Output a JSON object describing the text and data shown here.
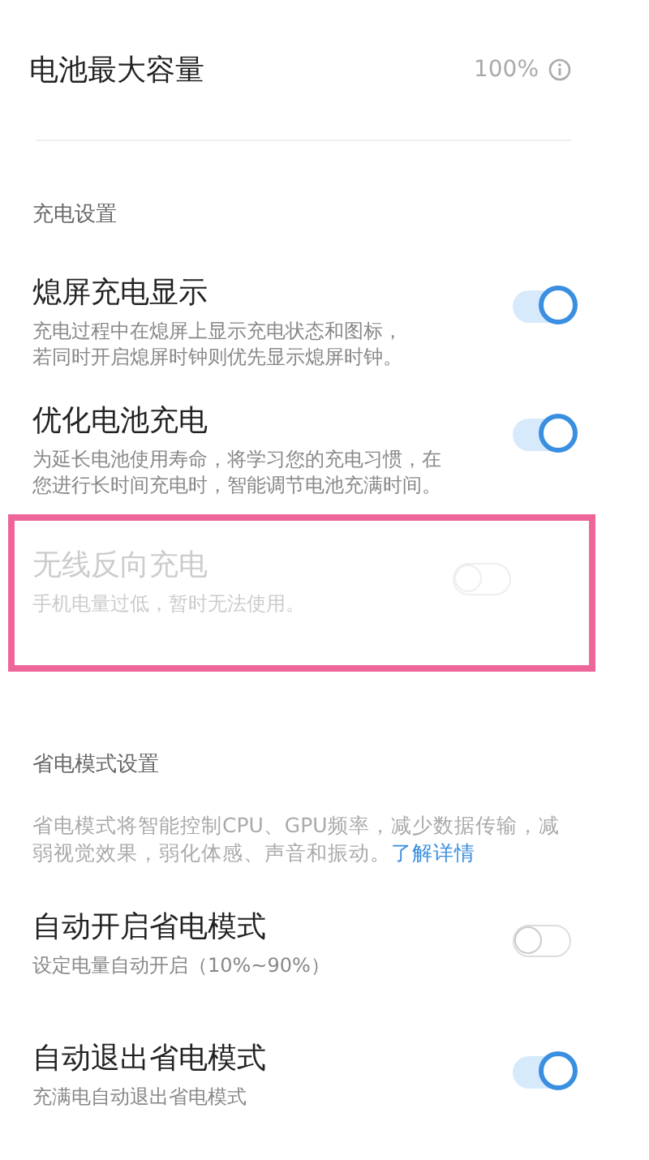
{
  "capacity": {
    "label": "电池最大容量",
    "value": "100%"
  },
  "sections": [
    {
      "title": "充电设置",
      "items": [
        {
          "title": "熄屏充电显示",
          "subtitle": "充电过程中在熄屏上显示充电状态和图标，若同时开启熄屏时钟则优先显示熄屏时钟。",
          "on": true,
          "disabled": false,
          "highlighted": false
        },
        {
          "title": "优化电池充电",
          "subtitle": "为延长电池使用寿命，将学习您的充电习惯，在您进行长时间充电时，智能调节电池充满时间。",
          "on": true,
          "disabled": false,
          "highlighted": false
        },
        {
          "title": "无线反向充电",
          "subtitle": "手机电量过低，暂时无法使用。",
          "on": false,
          "disabled": true,
          "highlighted": true
        }
      ]
    },
    {
      "title": "省电模式设置",
      "description": "省电模式将智能控制CPU、GPU频率，减少数据传输，减弱视觉效果，弱化体感、声音和振动。",
      "link": "了解详情",
      "items": [
        {
          "title": "自动开启省电模式",
          "subtitle": "设定电量自动开启（10%~90%）",
          "on": false,
          "disabled": false,
          "highlighted": false
        },
        {
          "title": "自动退出省电模式",
          "subtitle": "充满电自动退出省电模式",
          "on": true,
          "disabled": false,
          "highlighted": false
        }
      ]
    }
  ]
}
